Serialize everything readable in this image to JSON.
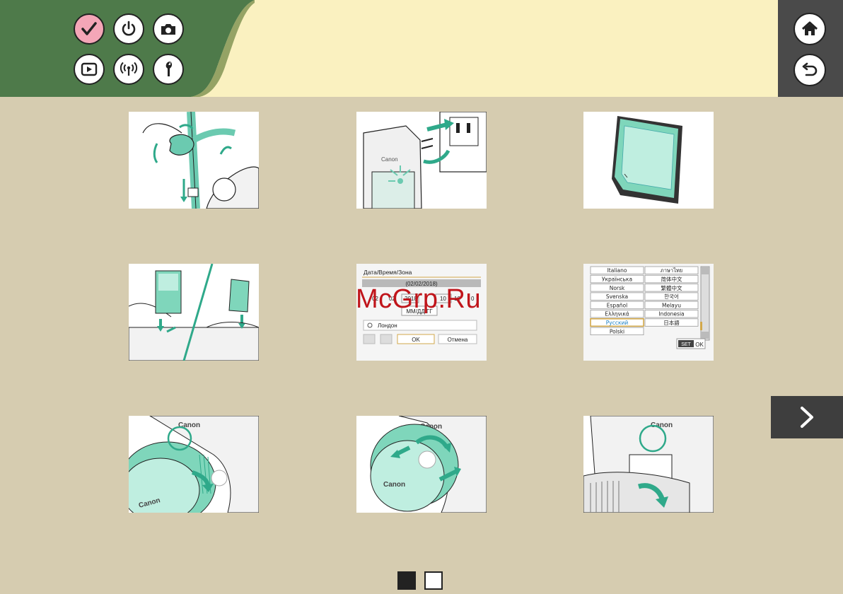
{
  "header": {
    "colors": {
      "green": "#4e7a4a",
      "cream": "#faf1c0",
      "dark": "#4a4a4a",
      "pink": "#f4a6b7"
    },
    "nav_icons": [
      "checkmark-icon",
      "power-icon",
      "camera-icon",
      "playback-icon",
      "wireless-icon",
      "wrench-icon"
    ],
    "right_icons": [
      "home-icon",
      "back-icon"
    ]
  },
  "thumbnails": {
    "date_screen": {
      "title": "Дата/Время/Зона",
      "date": "(02/02/2018)",
      "day": "02",
      "month": "02",
      "year": "2018",
      "hour": "10",
      "minute": "10",
      "ampm_hint": "0",
      "format": "ММ/ДД/ГГ",
      "zone": "Лондон",
      "ok": "OK",
      "cancel": "Отмена"
    },
    "language_screen": {
      "left_column": [
        "Italiano",
        "Українська",
        "Norsk",
        "Svenska",
        "Español",
        "Ελληνικά",
        "Русский",
        "Polski"
      ],
      "right_column": [
        "ภาษาไทย",
        "简体中文",
        "繁體中文",
        "한국어",
        "Melayu",
        "Indonesia",
        "日本語"
      ],
      "selected": "Русский",
      "set_label": "SET",
      "ok_label": "OK"
    },
    "brand": "Canon"
  },
  "watermark": "McGrp.Ru",
  "pagination": {
    "current": 1,
    "total": 2
  }
}
